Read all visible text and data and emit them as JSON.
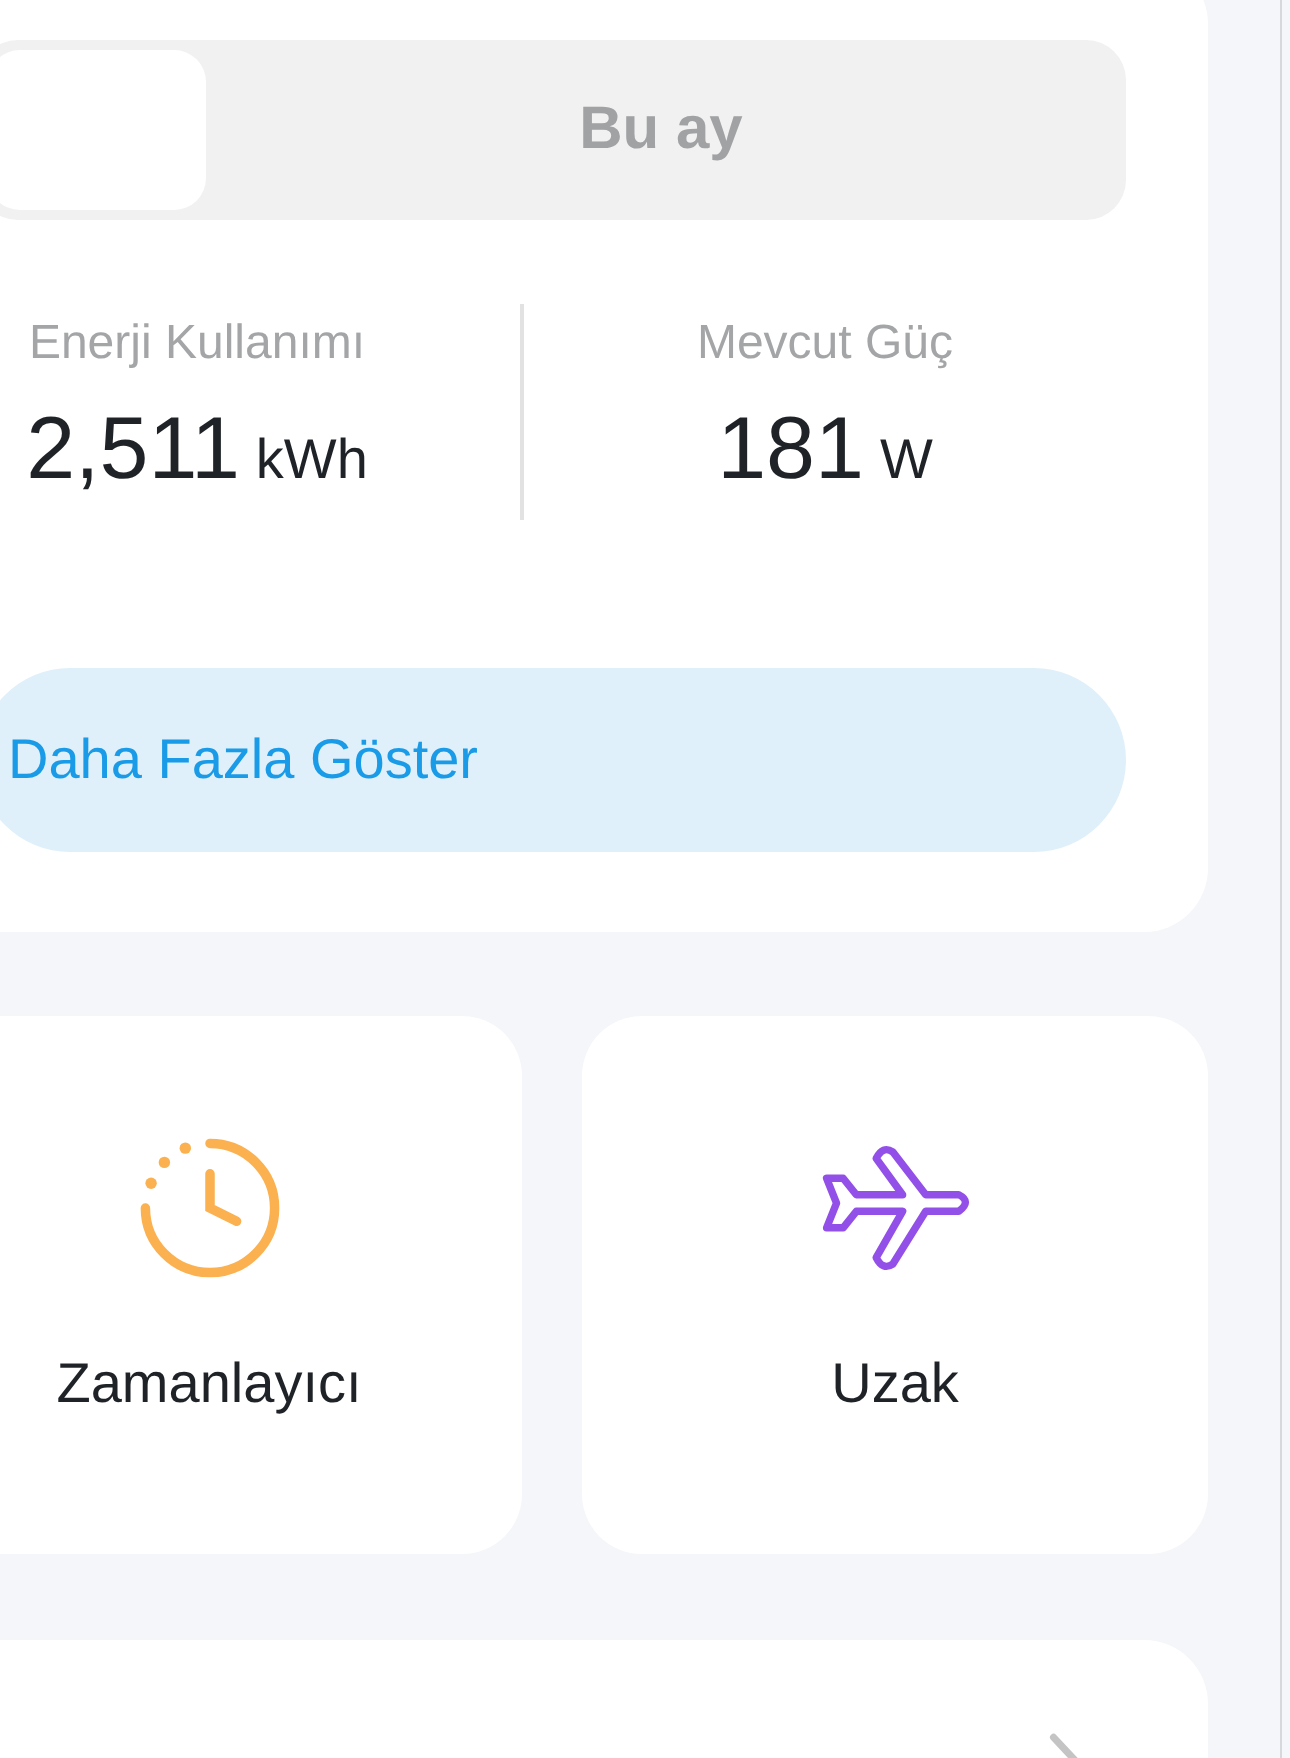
{
  "period_tabs": [
    {
      "selected": true
    },
    {
      "label": "Bu ay",
      "selected": false
    }
  ],
  "stats": [
    {
      "label": "Enerji Kullanımı",
      "value": "2,511",
      "unit": "kWh"
    },
    {
      "label": "Mevcut Güç",
      "value": "181",
      "unit": "W"
    }
  ],
  "more_button": "Daha Fazla Göster",
  "tiles": [
    {
      "kind": "timer",
      "label": "Zamanlayıcı"
    },
    {
      "kind": "plane",
      "label": "Uzak"
    }
  ]
}
